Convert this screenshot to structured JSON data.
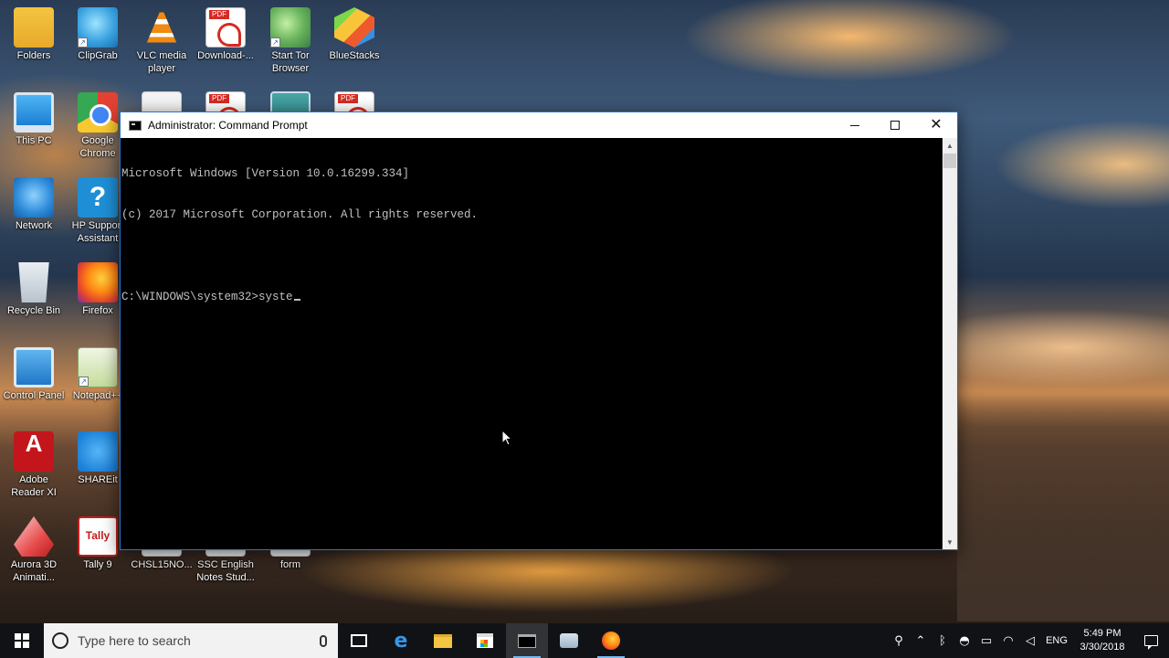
{
  "desktop": {
    "icons": [
      {
        "label": "Folders",
        "icon": "folder-icon"
      },
      {
        "label": "ClipGrab",
        "icon": "clipgrab-icon"
      },
      {
        "label": "VLC media player",
        "icon": "vlc-icon"
      },
      {
        "label": "Download-...",
        "icon": "pdf-file-icon"
      },
      {
        "label": "Start Tor Browser",
        "icon": "tor-browser-icon"
      },
      {
        "label": "BlueStacks",
        "icon": "bluestacks-icon"
      },
      {
        "label": "This PC",
        "icon": "this-pc-icon"
      },
      {
        "label": "Google Chrome",
        "icon": "chrome-icon"
      },
      {
        "label": "Network",
        "icon": "network-icon"
      },
      {
        "label": "HP Support Assistant",
        "icon": "hp-support-icon"
      },
      {
        "label": "Recycle Bin",
        "icon": "recycle-bin-icon"
      },
      {
        "label": "Firefox",
        "icon": "firefox-icon"
      },
      {
        "label": "Control Panel",
        "icon": "control-panel-icon"
      },
      {
        "label": "Notepad++",
        "icon": "notepad-icon"
      },
      {
        "label": "Adobe Reader XI",
        "icon": "adobe-reader-icon"
      },
      {
        "label": "SHAREit",
        "icon": "shareit-icon"
      },
      {
        "label": "Aurora 3D Animati...",
        "icon": "aurora-3d-icon"
      },
      {
        "label": "Tally 9",
        "icon": "tally-icon"
      },
      {
        "label": "CHSL15NO...",
        "icon": "file-icon"
      },
      {
        "label": "SSC English Notes Stud...",
        "icon": "file-icon"
      },
      {
        "label": "form",
        "icon": "file-icon"
      }
    ]
  },
  "cmd": {
    "title": "Administrator: Command Prompt",
    "lines": [
      "Microsoft Windows [Version 10.0.16299.334]",
      "(c) 2017 Microsoft Corporation. All rights reserved.",
      "",
      "C:\\WINDOWS\\system32>syste"
    ],
    "minimize_glyph": "",
    "close_glyph": "✕"
  },
  "taskbar": {
    "search_placeholder": "Type here to search",
    "apps": [
      "task-view",
      "edge",
      "file-explorer",
      "store",
      "command-prompt",
      "control-panel",
      "firefox"
    ],
    "tray": {
      "language": "ENG",
      "time": "5:49 PM",
      "date": "3/30/2018"
    }
  },
  "colors": {
    "titlebar_bg": "#ffffff",
    "console_bg": "#000000",
    "console_fg": "#c0c0c0",
    "taskbar_bg": "#101216",
    "accent": "#76b9ed"
  }
}
